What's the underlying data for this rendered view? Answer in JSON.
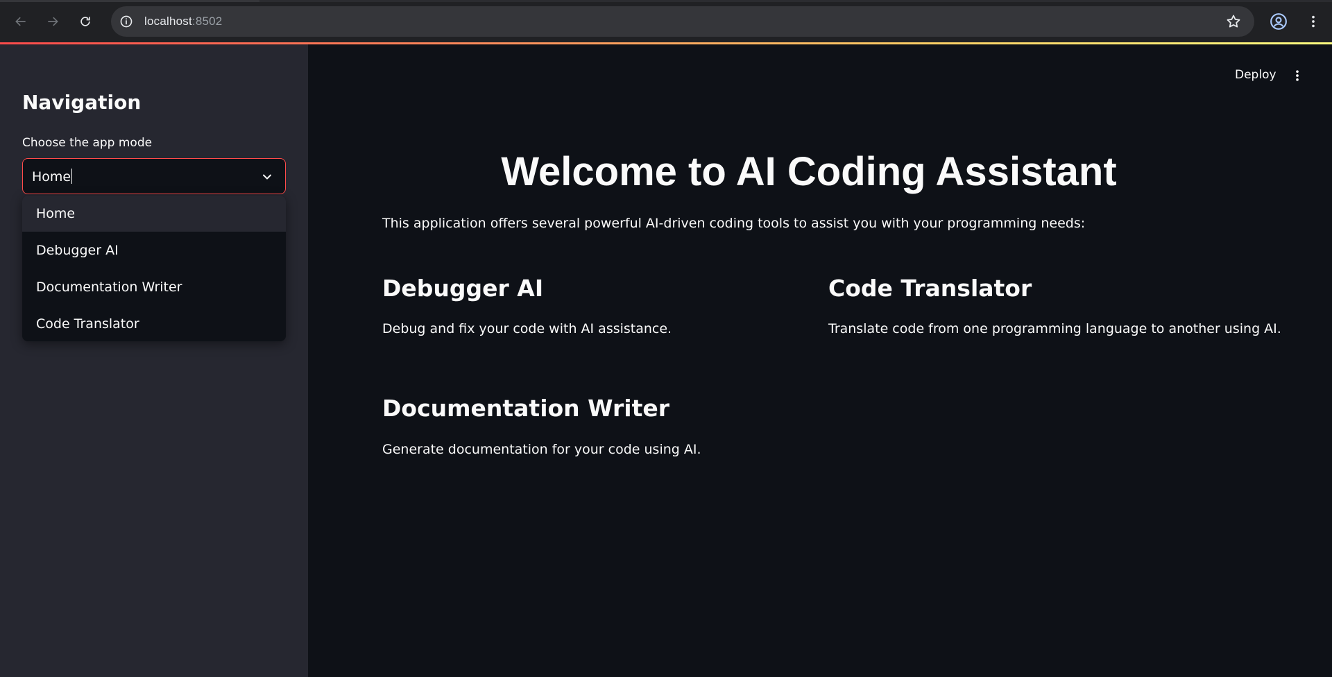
{
  "browser": {
    "url_host": "localhost",
    "url_port": ":8502",
    "icons": [
      "back-arrow-icon",
      "forward-arrow-icon",
      "reload-icon",
      "site-info-icon",
      "bookmark-star-icon",
      "profile-icon",
      "browser-menu-icon"
    ]
  },
  "sidebar": {
    "title": "Navigation",
    "select_label": "Choose the app mode",
    "select_value": "Home",
    "options": [
      "Home",
      "Debugger AI",
      "Documentation Writer",
      "Code Translator"
    ]
  },
  "header": {
    "deploy_label": "Deploy"
  },
  "main": {
    "title": "Welcome to AI Coding Assistant",
    "intro": "This application offers several powerful AI-driven coding tools to assist you with your programming needs:",
    "features": [
      {
        "title": "Debugger AI",
        "desc": "Debug and fix your code with AI assistance."
      },
      {
        "title": "Code Translator",
        "desc": "Translate code from one programming language to another using AI."
      },
      {
        "title": "Documentation Writer",
        "desc": "Generate documentation for your code using AI."
      }
    ]
  },
  "colors": {
    "accent": "#ff4b4b",
    "background": "#0e1117",
    "sidebar": "#262730",
    "text": "#fafafa"
  }
}
